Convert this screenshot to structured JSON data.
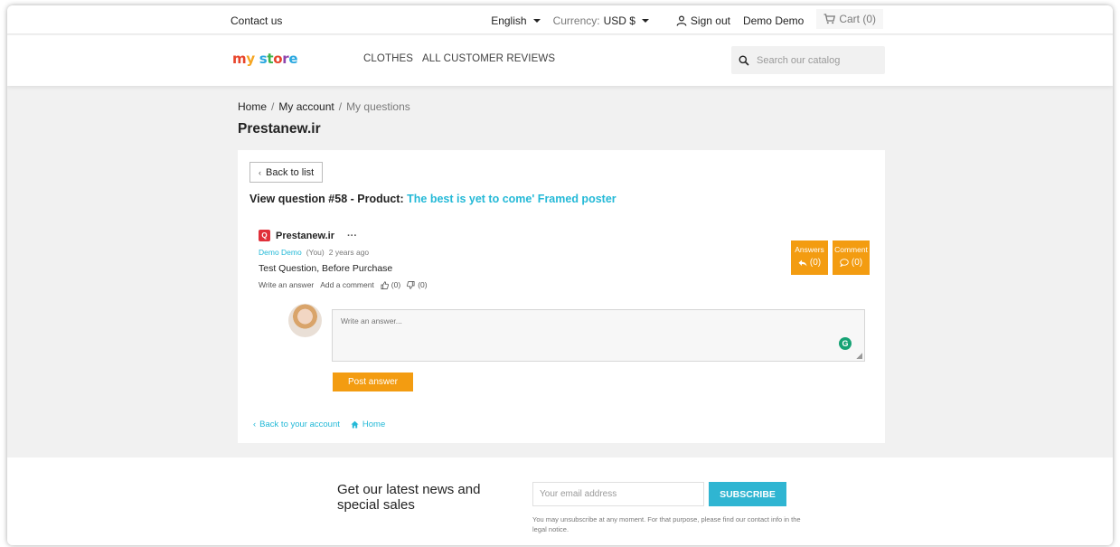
{
  "topbar": {
    "contact": "Contact us",
    "language": "English",
    "currency_label": "Currency:",
    "currency_value": "USD $",
    "signout": "Sign out",
    "username": "Demo Demo",
    "cart": "Cart (0)"
  },
  "header": {
    "logo": [
      "m",
      "y",
      " ",
      "s",
      "t",
      "o",
      "r",
      "e"
    ],
    "nav": [
      "CLOTHES",
      "ALL CUSTOMER REVIEWS"
    ],
    "search_placeholder": "Search our catalog"
  },
  "breadcrumb": {
    "home": "Home",
    "account": "My account",
    "current": "My questions",
    "sep": "/"
  },
  "page_title": "Prestanew.ir",
  "card": {
    "back_label": "Back to list",
    "view_prefix": "View question #58 - Product:",
    "product_name": "The best is yet to come' Framed poster",
    "question": {
      "badge": "Q",
      "site": "Prestanew.ir",
      "more": "···",
      "author": "Demo Demo",
      "you": "(You)",
      "time": "2 years ago",
      "text": "Test Question, Before Purchase",
      "write_answer": "Write an answer",
      "add_comment": "Add a comment",
      "likes": "(0)",
      "dislikes": "(0)"
    },
    "answers_counter": {
      "label": "Answers",
      "value": "(0)"
    },
    "comment_counter": {
      "label": "Comment",
      "value": "(0)"
    },
    "answer_placeholder": "Write an answer...",
    "post_answer": "Post answer",
    "back_account": "Back to your account",
    "home": "Home"
  },
  "newsletter": {
    "title": "Get our latest news and special sales",
    "email_placeholder": "Your email address",
    "subscribe": "SUBSCRIBE",
    "note": "You may unsubscribe at any moment. For that purpose, please find our contact info in the legal notice."
  },
  "colors": {
    "accent": "#24b9d7",
    "orange": "#f39c11",
    "subscribe": "#2fb5d2",
    "badge_red": "#e0303a"
  }
}
